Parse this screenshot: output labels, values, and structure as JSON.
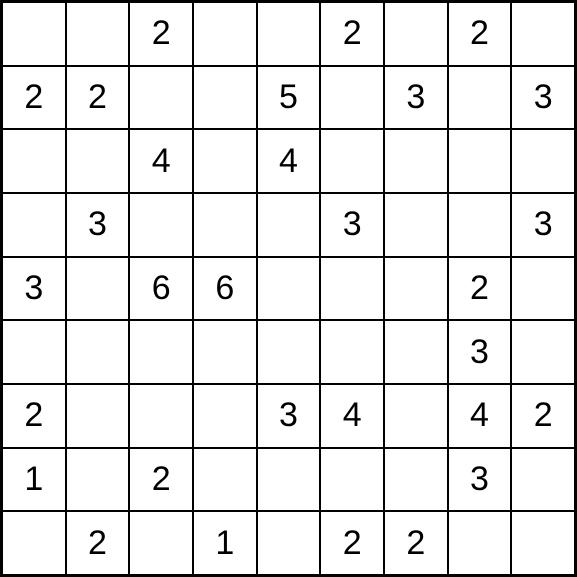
{
  "grid": {
    "rows": 9,
    "cols": 9,
    "cells": [
      [
        "",
        "",
        "2",
        "",
        "",
        "2",
        "",
        "2",
        ""
      ],
      [
        "2",
        "2",
        "",
        "",
        "5",
        "",
        "3",
        "",
        "3"
      ],
      [
        "",
        "",
        "4",
        "",
        "4",
        "",
        "",
        "",
        ""
      ],
      [
        "",
        "3",
        "",
        "",
        "",
        "3",
        "",
        "",
        "3"
      ],
      [
        "3",
        "",
        "6",
        "6",
        "",
        "",
        "",
        "2",
        ""
      ],
      [
        "",
        "",
        "",
        "",
        "",
        "",
        "",
        "3",
        ""
      ],
      [
        "2",
        "",
        "",
        "",
        "3",
        "4",
        "",
        "4",
        "2"
      ],
      [
        "1",
        "",
        "2",
        "",
        "",
        "",
        "",
        "3",
        ""
      ],
      [
        "",
        "2",
        "",
        "1",
        "",
        "2",
        "2",
        "",
        ""
      ]
    ]
  }
}
